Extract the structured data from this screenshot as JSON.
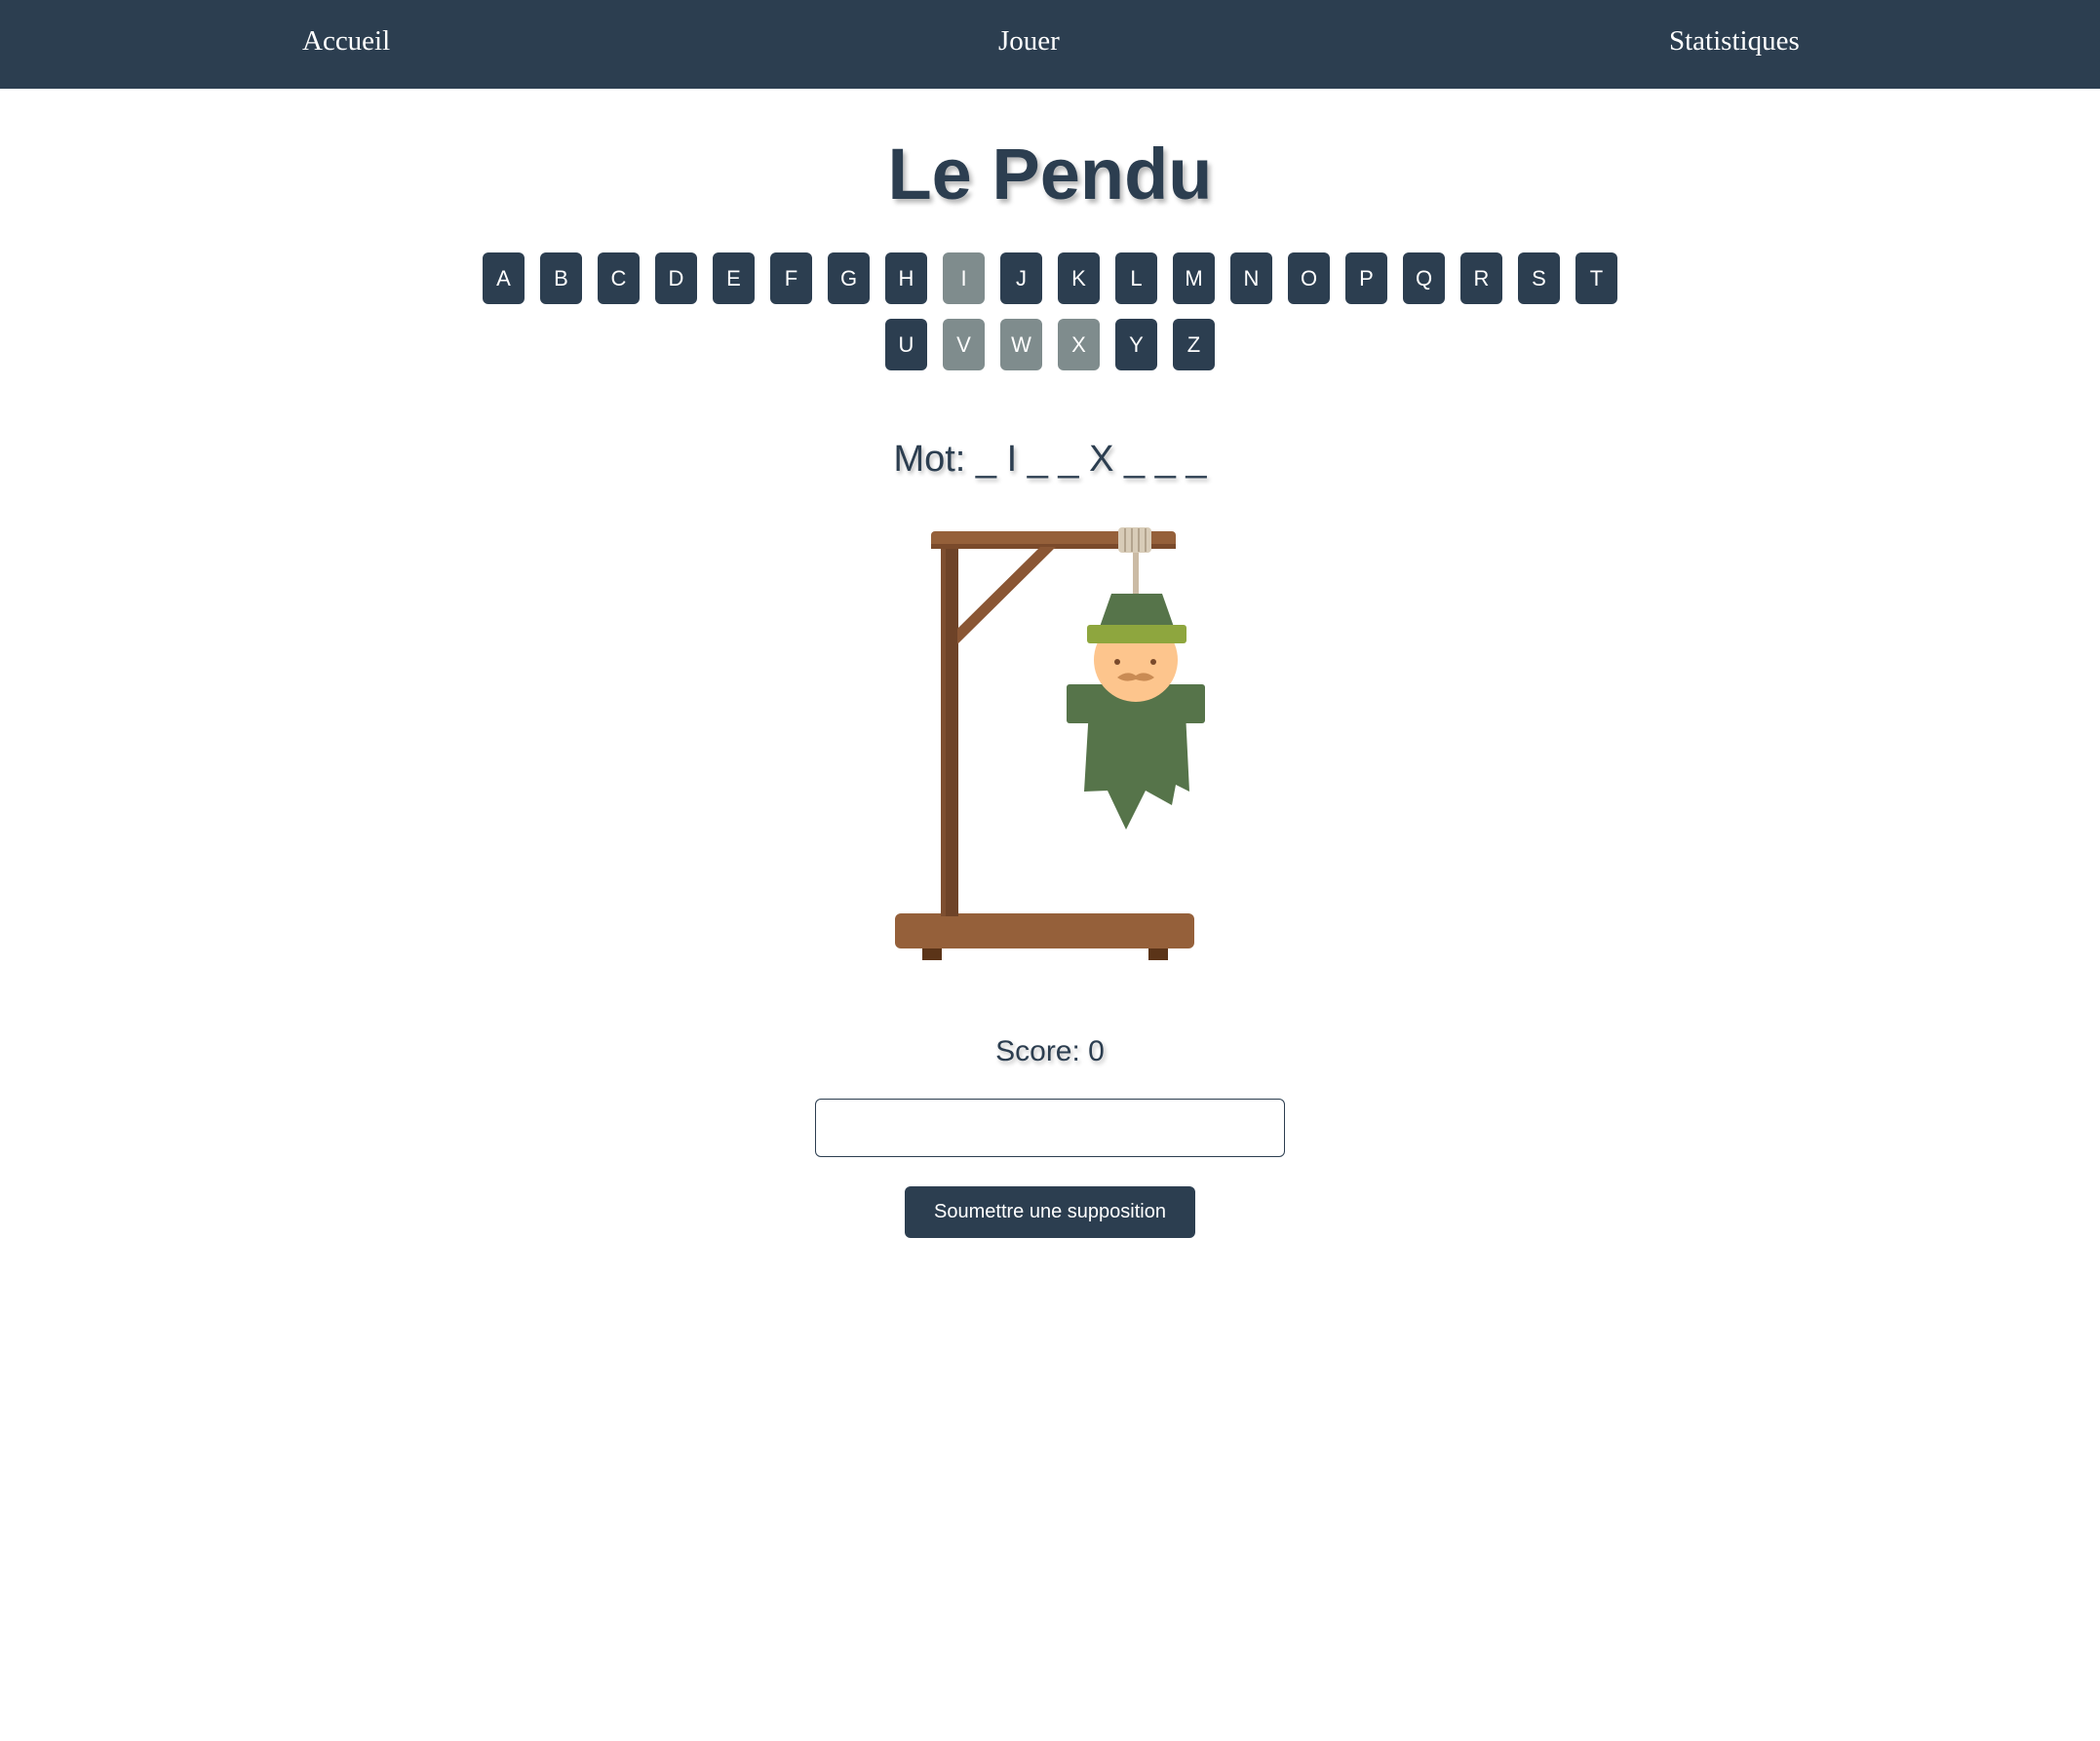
{
  "nav": {
    "items": [
      "Accueil",
      "Jouer",
      "Statistiques"
    ]
  },
  "game": {
    "title": "Le Pendu",
    "letters_row1": [
      "A",
      "B",
      "C",
      "D",
      "E",
      "F",
      "G",
      "H",
      "I",
      "J",
      "K",
      "L",
      "M",
      "N",
      "O",
      "P",
      "Q",
      "R",
      "S",
      "T"
    ],
    "letters_row2": [
      "U",
      "V",
      "W",
      "X",
      "Y",
      "Z"
    ],
    "used_letters": [
      "I",
      "V",
      "W",
      "X"
    ],
    "word_display": "Mot: _ I _ _ X _ _ _",
    "score_text": "Score: 0",
    "guess_value": "",
    "submit_label": "Soumettre une supposition"
  },
  "colors": {
    "primary": "#2c3e50",
    "key_used": "#7f8c8d",
    "wood_dark": "#6e4328",
    "wood_light": "#95603a",
    "body_green": "#56744a",
    "hat_band": "#8ea63e",
    "skin": "#fdc58d"
  }
}
